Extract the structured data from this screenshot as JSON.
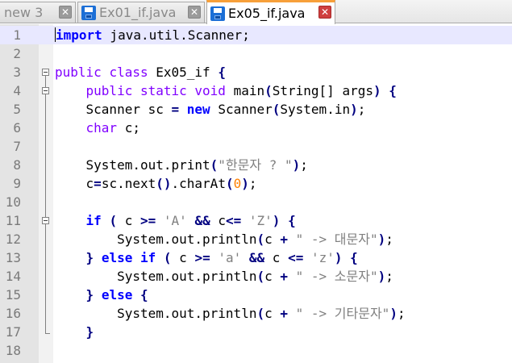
{
  "tabs": [
    {
      "label": "new 3",
      "icon": "file-icon",
      "active": false
    },
    {
      "label": "Ex01_if.java",
      "icon": "save-disk-icon",
      "active": false
    },
    {
      "label": "Ex05_if.java",
      "icon": "save-disk-icon",
      "active": true
    }
  ],
  "close_symbol": "✕",
  "line_numbers": [
    "1",
    "2",
    "3",
    "4",
    "5",
    "6",
    "7",
    "8",
    "9",
    "10",
    "11",
    "12",
    "13",
    "14",
    "15",
    "16",
    "17",
    "18"
  ],
  "code": {
    "l1_kw": "import",
    "l1_rest": " java.util.Scanner;",
    "l3_public": "public",
    "l3_class": "class",
    "l3_name": " Ex05_if ",
    "l3_brace": "{",
    "l4_public": "public",
    "l4_static": "static",
    "l4_void": "void",
    "l4_main": " main",
    "l4_args": "String[] args",
    "l4_brace": "{",
    "l5_a": "Scanner sc ",
    "l5_eq": "=",
    "l5_new": "new",
    "l5_b": " Scanner",
    "l5_c": "System.in",
    "l6_char": "char",
    "l6_rest": " c;",
    "l8_a": "System.out.print",
    "l8_str": "\"한문자 ? \"",
    "l9_a": "c",
    "l9_eq": "=",
    "l9_b": "sc.next",
    "l9_c": ".charAt",
    "l9_num": "0",
    "l11_if": "if",
    "l11_c1": " c ",
    "l11_ge": ">=",
    "l11_A": "'A'",
    "l11_and": "&&",
    "l11_c2": " c",
    "l11_le": "<=",
    "l11_Z": "'Z'",
    "l12_a": "System.out.println",
    "l12_c": "c ",
    "l12_plus": "+",
    "l12_str": "\" -> 대문자\"",
    "l13_else": "else",
    "l13_if": "if",
    "l13_c1": " c ",
    "l13_ge": ">=",
    "l13_a": "'a'",
    "l13_and": "&&",
    "l13_c2": " c ",
    "l13_le": "<=",
    "l13_z": "'z'",
    "l14_str": "\" -> 소문자\"",
    "l15_else": "else",
    "l16_str": "\" -> 기타문자\""
  }
}
